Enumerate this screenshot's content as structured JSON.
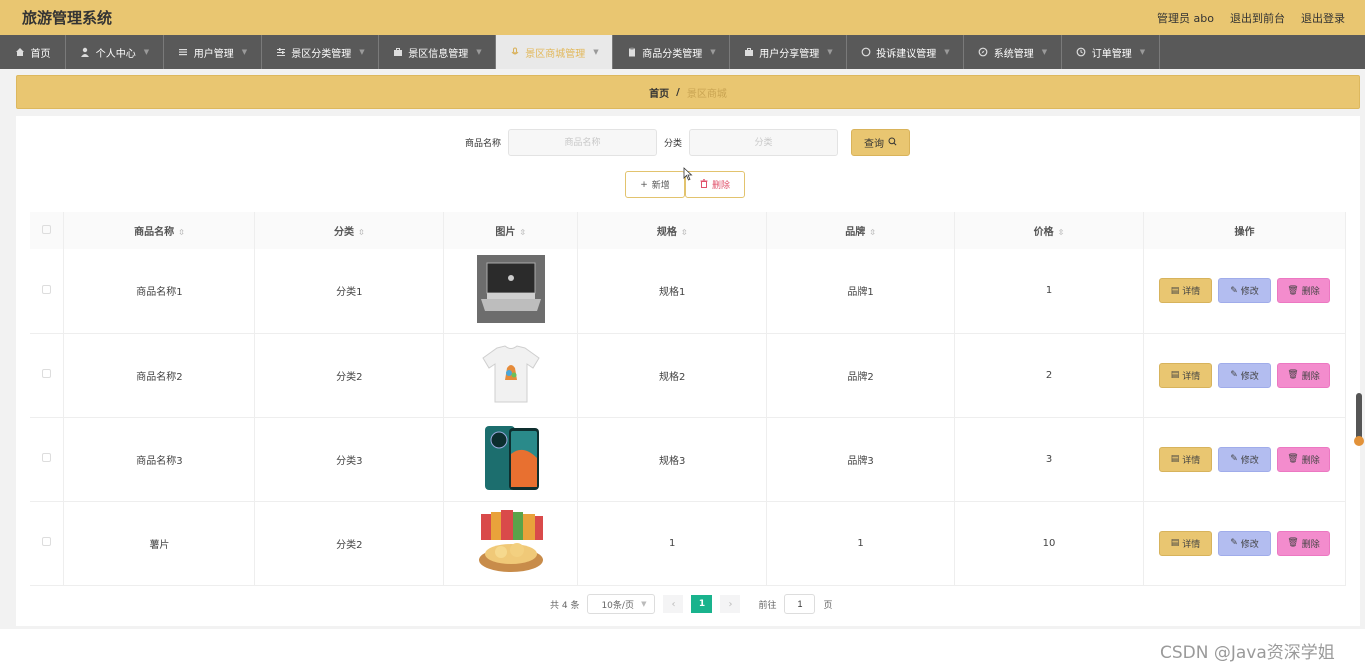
{
  "header": {
    "app_title": "旅游管理系统",
    "admin_label": "管理员 abo",
    "to_frontend": "退出到前台",
    "logout": "退出登录",
    "bg_color": "#e9c671"
  },
  "nav": [
    {
      "label": "首页",
      "icon": "home-icon"
    },
    {
      "label": "个人中心",
      "icon": "user-icon"
    },
    {
      "label": "用户管理",
      "icon": "list-icon"
    },
    {
      "label": "景区分类管理",
      "icon": "sliders-icon"
    },
    {
      "label": "景区信息管理",
      "icon": "briefcase-icon"
    },
    {
      "label": "景区商城管理",
      "icon": "mic-icon"
    },
    {
      "label": "商品分类管理",
      "icon": "clipboard-icon"
    },
    {
      "label": "用户分享管理",
      "icon": "briefcase-icon"
    },
    {
      "label": "投诉建议管理",
      "icon": "circle-icon"
    },
    {
      "label": "系统管理",
      "icon": "compass-icon"
    },
    {
      "label": "订单管理",
      "icon": "clock-icon"
    }
  ],
  "breadcrumb": {
    "home": "首页",
    "separator": "/",
    "current": "景区商城"
  },
  "search": {
    "name_label": "商品名称",
    "name_placeholder": "商品名称",
    "category_label": "分类",
    "category_placeholder": "分类",
    "query_button": "查询"
  },
  "actions": {
    "add_label": "新增",
    "delete_label": "删除"
  },
  "table": {
    "columns": [
      "商品名称",
      "分类",
      "图片",
      "规格",
      "品牌",
      "价格",
      "操作"
    ],
    "rows": [
      {
        "name": "商品名称1",
        "category": "分类1",
        "image": "laptop",
        "spec": "规格1",
        "brand": "品牌1",
        "price": "1"
      },
      {
        "name": "商品名称2",
        "category": "分类2",
        "image": "tshirt",
        "spec": "规格2",
        "brand": "品牌2",
        "price": "2"
      },
      {
        "name": "商品名称3",
        "category": "分类3",
        "image": "phone",
        "spec": "规格3",
        "brand": "品牌3",
        "price": "3"
      },
      {
        "name": "薯片",
        "category": "分类2",
        "image": "chips",
        "spec": "1",
        "brand": "1",
        "price": "10"
      }
    ],
    "row_actions": {
      "detail": "详情",
      "edit": "修改",
      "delete": "删除"
    }
  },
  "pagination": {
    "total": "共 4 条",
    "page_size": "10条/页",
    "current_page": "1",
    "goto_label": "前往",
    "goto_value": "1",
    "page_suffix": "页"
  },
  "watermark": "CSDN @Java资深学姐",
  "colors": {
    "accent": "#e9c671",
    "nav_bg": "#595959",
    "page_active": "#19b38d",
    "edit": "#b3bdf0",
    "delete": "#f38ccd"
  }
}
